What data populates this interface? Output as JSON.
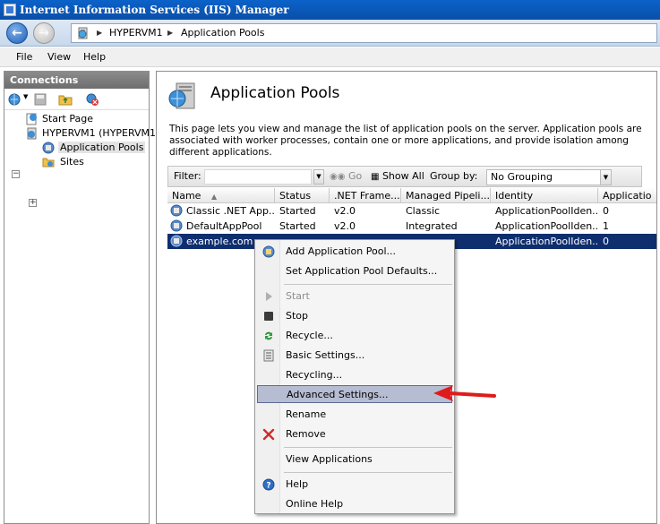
{
  "window": {
    "title": "Internet Information Services (IIS) Manager"
  },
  "address": {
    "crumbs": [
      "HYPERVM1",
      "Application Pools"
    ]
  },
  "menu": {
    "items": [
      "File",
      "View",
      "Help"
    ]
  },
  "connections": {
    "header": "Connections",
    "tree": [
      {
        "label": "Start Page"
      },
      {
        "label": "HYPERVM1 (HYPERVM1\\A"
      },
      {
        "label": "Application Pools"
      },
      {
        "label": "Sites"
      }
    ]
  },
  "main": {
    "title": "Application Pools",
    "description": "This page lets you view and manage the list of application pools on the server. Application pools are associated with worker processes, contain one or more applications, and provide isolation among different applications.",
    "filter": {
      "label": "Filter:",
      "go": "Go",
      "show_all": "Show All",
      "group_by_label": "Group by:",
      "group_by_value": "No Grouping"
    },
    "columns": [
      "Name",
      "Status",
      ".NET Frame...",
      "Managed Pipeli...",
      "Identity",
      "Applicatio"
    ],
    "rows": [
      {
        "name": "Classic .NET App...",
        "status": "Started",
        "net": "v2.0",
        "pipeline": "Classic",
        "identity": "ApplicationPoolIden...",
        "apps": "0"
      },
      {
        "name": "DefaultAppPool",
        "status": "Started",
        "net": "v2.0",
        "pipeline": "Integrated",
        "identity": "ApplicationPoolIden...",
        "apps": "1"
      },
      {
        "name": "example.com",
        "status": "",
        "net": "",
        "pipeline": "",
        "identity": "ApplicationPoolIden...",
        "apps": "0"
      }
    ]
  },
  "context_menu": {
    "items": {
      "add": "Add Application Pool...",
      "defaults": "Set Application Pool Defaults...",
      "start": "Start",
      "stop": "Stop",
      "recycle": "Recycle...",
      "basic": "Basic Settings...",
      "recycling": "Recycling...",
      "advanced": "Advanced Settings...",
      "rename": "Rename",
      "remove": "Remove",
      "view_apps": "View Applications",
      "help": "Help",
      "online_help": "Online Help"
    }
  },
  "colors": {
    "title_bar": "#0a58b8",
    "selected_row": "#0f2e6e",
    "menu_highlight": "#b6bdd2",
    "annotation_arrow": "#e01b1b"
  }
}
